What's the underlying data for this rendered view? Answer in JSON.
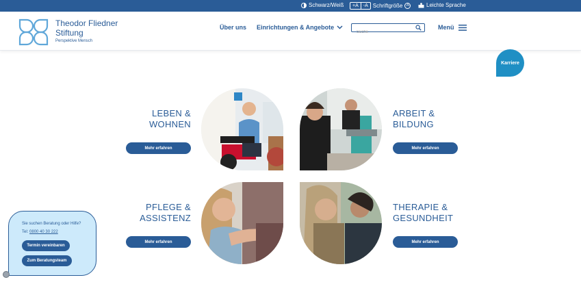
{
  "topbar": {
    "contrast_label": "Schwarz/Weiß",
    "font_plus": "+A",
    "font_minus": "-A",
    "font_label": "Schriftgröße",
    "font_icon_letter": "A",
    "easy_language_label": "Leichte Sprache"
  },
  "brand": {
    "name_line1": "Theodor Fliedner",
    "name_line2": "Stiftung",
    "tagline": "Perspektive Mensch"
  },
  "nav": {
    "about": "Über uns",
    "institutions": "Einrichtungen & Angebote",
    "search_placeholder": "Suche",
    "menu": "Menü"
  },
  "karriere": "Karriere",
  "categories": [
    {
      "title1": "LEBEN &",
      "title2": "WOHNEN",
      "button": "Mehr erfahren"
    },
    {
      "title1": "ARBEIT &",
      "title2": "BILDUNG",
      "button": "Mehr erfahren"
    },
    {
      "title1": "PFLEGE &",
      "title2": "ASSISTENZ",
      "button": "Mehr erfahren"
    },
    {
      "title1": "THERAPIE &",
      "title2": "GESUNDHEIT",
      "button": "Mehr erfahren"
    }
  ],
  "help": {
    "question": "Sie suchen Beratung oder Hilfe?",
    "tel_prefix": "Tel: ",
    "tel_number": "0800 40 30 222",
    "appointment_button": "Termin vereinbaren",
    "team_button": "Zum Beratungsteam"
  },
  "colors": {
    "brand_blue": "#2a5c97",
    "accent_blue": "#1f8fc4",
    "help_bg": "#cdeafb"
  }
}
